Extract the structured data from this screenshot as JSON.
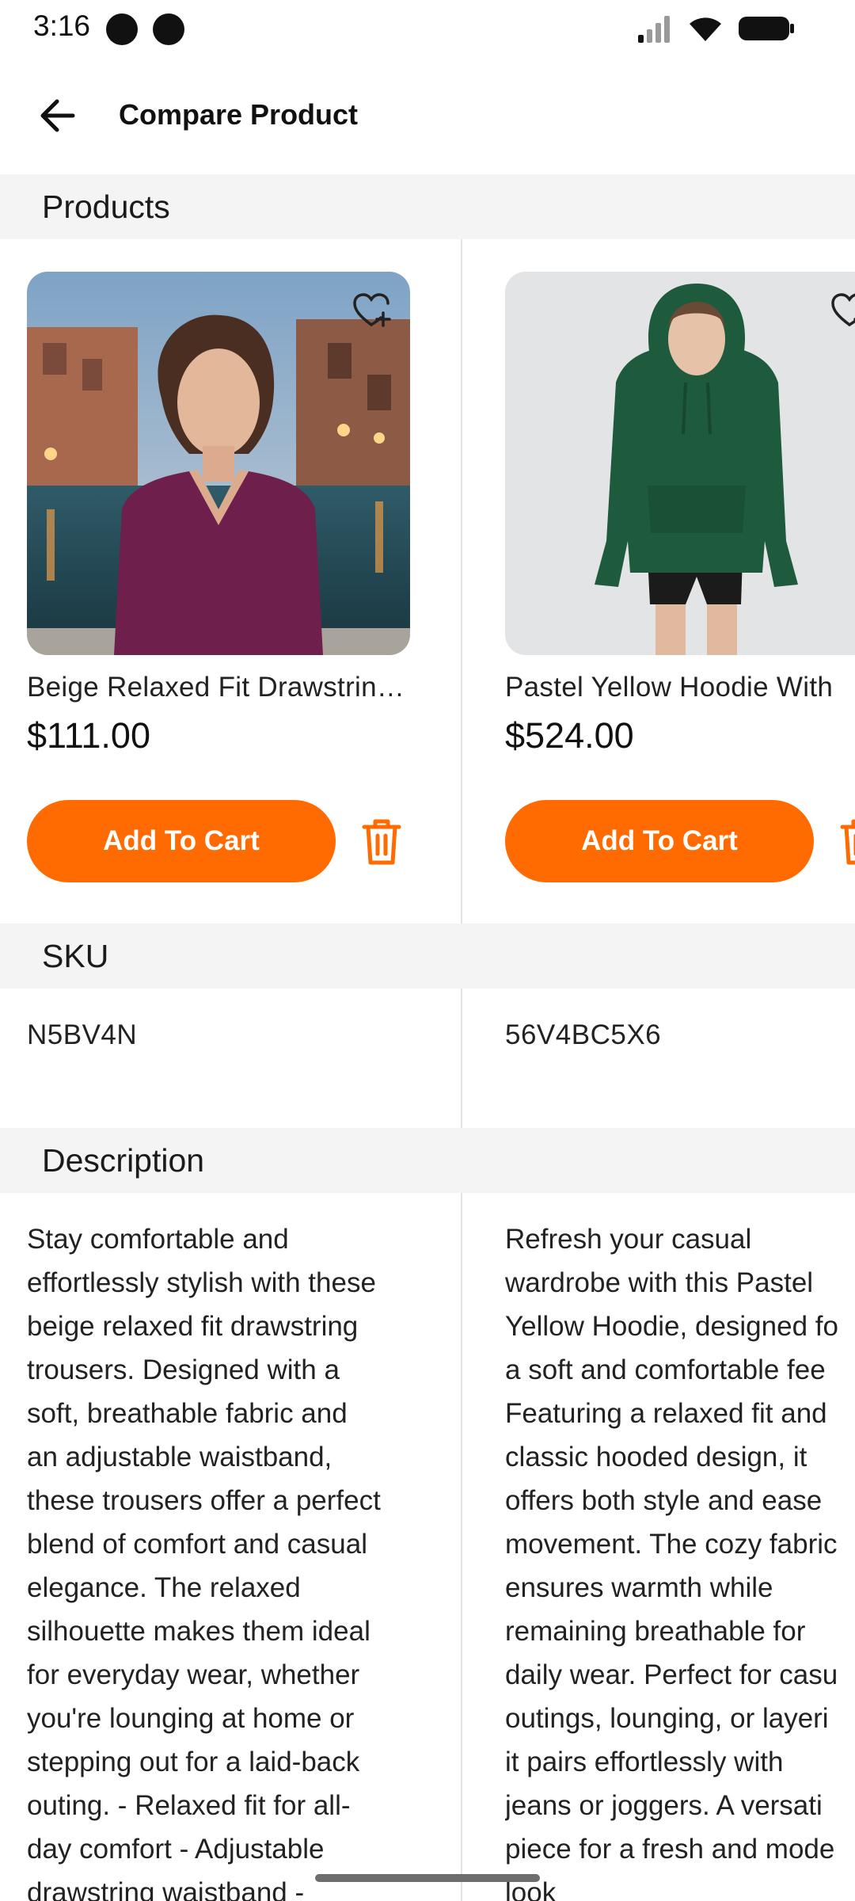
{
  "status_bar": {
    "time": "3:16"
  },
  "top_bar": {
    "title": "Compare Product",
    "back_icon": "arrow-left-icon"
  },
  "sections": {
    "products": "Products",
    "sku": "SKU",
    "description": "Description"
  },
  "products": [
    {
      "name": "Beige Relaxed Fit Drawstrin…",
      "price": "$111.00",
      "add_to_cart": "Add To Cart",
      "sku": "N5BV4N",
      "description": "Stay comfortable and\neffortlessly stylish with these\nbeige relaxed fit drawstring\ntrousers. Designed with a\nsoft, breathable fabric and\nan adjustable waistband,\nthese trousers offer a perfect\nblend of comfort and casual\nelegance. The relaxed\nsilhouette makes them ideal\nfor everyday wear, whether\nyou're lounging at home or\nstepping out for a laid-back\nouting. - Relaxed fit for all-\nday comfort - Adjustable\ndrawstring waistband -"
    },
    {
      "name": "Pastel Yellow Hoodie With",
      "price": "$524.00",
      "add_to_cart": "Add To Cart",
      "sku": "56V4BC5X6",
      "description": "Refresh your casual\nwardrobe with this Pastel\nYellow Hoodie, designed fo\na soft and comfortable fee\nFeaturing a relaxed fit and\nclassic hooded design, it\noffers both style and ease\nmovement. The cozy fabric\nensures warmth while\nremaining breathable for\ndaily wear. Perfect for casu\noutings, lounging, or layeri\nit pairs effortlessly with\njeans or joggers. A versati\npiece for a fresh and mode\nlook"
    }
  ],
  "colors": {
    "accent": "#ff6b00",
    "section_bg": "#f4f4f4"
  }
}
